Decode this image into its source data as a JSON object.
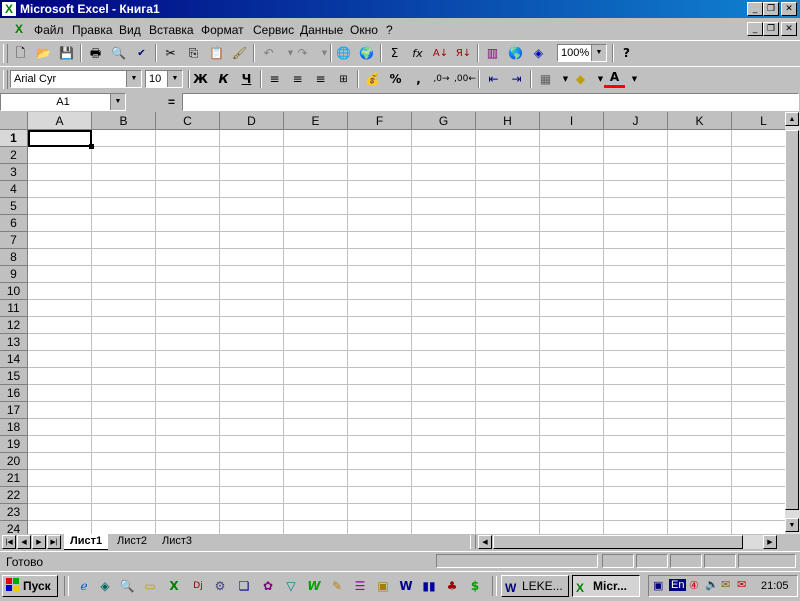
{
  "window": {
    "title": "Microsoft Excel - Книга1",
    "minimize_icon": "minimize-icon",
    "restore_icon": "restore-icon",
    "close_icon": "close-icon"
  },
  "menu": {
    "items": [
      "Файл",
      "Правка",
      "Вид",
      "Вставка",
      "Формат",
      "Сервис",
      "Данные",
      "Окно",
      "?"
    ]
  },
  "standard_toolbar": {
    "zoom": "100%",
    "icons": [
      "new-icon",
      "open-icon",
      "save-icon",
      "print-icon",
      "print-preview-icon",
      "spelling-icon",
      "cut-icon",
      "copy-icon",
      "paste-icon",
      "format-painter-icon",
      "undo-icon",
      "redo-icon",
      "hyperlink-icon",
      "web-toolbar-icon",
      "autosum-icon",
      "function-icon",
      "sort-ascending-icon",
      "sort-descending-icon",
      "chart-wizard-icon",
      "map-icon",
      "drawing-icon",
      "help-icon"
    ]
  },
  "formatting_toolbar": {
    "font": "Arial Cyr",
    "size": "10",
    "bold": "Ж",
    "italic": "К",
    "underline": "Ч",
    "percent": "%",
    "comma": ","
  },
  "formula_bar": {
    "name_box": "A1",
    "equals": "=",
    "content": ""
  },
  "grid": {
    "columns": [
      "A",
      "B",
      "C",
      "D",
      "E",
      "F",
      "G",
      "H",
      "I",
      "J",
      "K",
      "L"
    ],
    "rows": [
      "1",
      "2",
      "3",
      "4",
      "5",
      "6",
      "7",
      "8",
      "9",
      "10",
      "11",
      "12",
      "13",
      "14",
      "15",
      "16",
      "17",
      "18",
      "19",
      "20",
      "21",
      "22",
      "23",
      "24"
    ],
    "active_cell": "A1"
  },
  "sheets": {
    "tabs": [
      "Лист1",
      "Лист2",
      "Лист3"
    ],
    "active": "Лист1"
  },
  "status": {
    "text": "Готово"
  },
  "taskbar": {
    "start": "Пуск",
    "buttons": [
      "LEKE...",
      "Micr..."
    ],
    "language": "En",
    "time": "21:05"
  },
  "colors": {
    "title_start": "#000080",
    "title_end": "#1084d0",
    "chrome": "#c0c0c0",
    "excel_green": "#008000"
  }
}
